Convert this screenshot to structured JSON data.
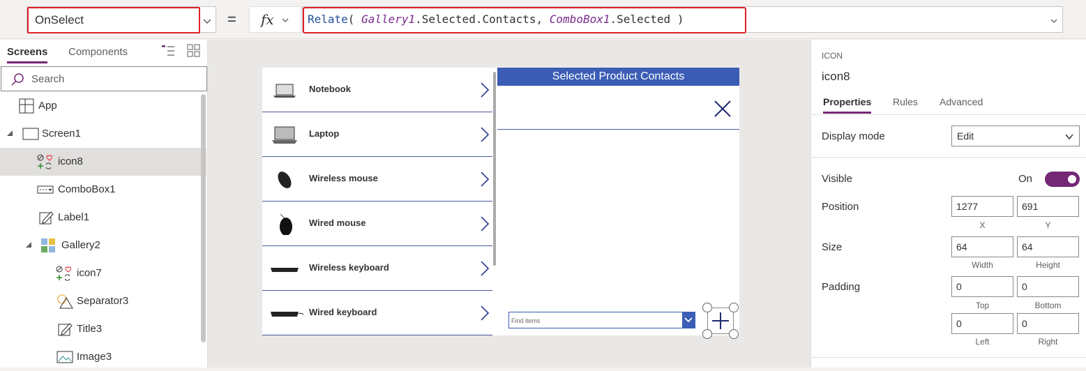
{
  "formula_bar": {
    "property": "OnSelect",
    "equals": "=",
    "fx_label": "fx",
    "formula": {
      "fn": "Relate",
      "p1": "( ",
      "gallery": "Gallery1",
      "mid": ".Selected.Contacts, ",
      "combo": "ComboBox1",
      "end": ".Selected )"
    }
  },
  "left_panel": {
    "tabs": [
      "Screens",
      "Components"
    ],
    "search_placeholder": "Search",
    "tree": [
      {
        "label": "App",
        "icon": "app-icon"
      },
      {
        "label": "Screen1",
        "icon": "screen-icon"
      },
      {
        "label": "icon8",
        "icon": "icon-control-icon",
        "selected": true
      },
      {
        "label": "ComboBox1",
        "icon": "combobox-icon"
      },
      {
        "label": "Label1",
        "icon": "label-icon"
      },
      {
        "label": "Gallery2",
        "icon": "gallery-icon"
      },
      {
        "label": "icon7",
        "icon": "icon-control-icon"
      },
      {
        "label": "Separator3",
        "icon": "shapes-icon"
      },
      {
        "label": "Title3",
        "icon": "label-icon"
      },
      {
        "label": "Image3",
        "icon": "image-icon"
      }
    ]
  },
  "canvas": {
    "gallery": [
      {
        "name": "Notebook",
        "icon": "notebook-image"
      },
      {
        "name": "Laptop",
        "icon": "laptop-image"
      },
      {
        "name": "Wireless mouse",
        "icon": "wireless-mouse-image"
      },
      {
        "name": "Wired mouse",
        "icon": "wired-mouse-image"
      },
      {
        "name": "Wireless keyboard",
        "icon": "wireless-keyboard-image"
      },
      {
        "name": "Wired keyboard",
        "icon": "wired-keyboard-image"
      }
    ],
    "panel_title": "Selected Product Contacts",
    "combo_placeholder": "Find items"
  },
  "properties": {
    "type": "ICON",
    "name": "icon8",
    "tabs": [
      "Properties",
      "Rules",
      "Advanced"
    ],
    "display_mode_label": "Display mode",
    "display_mode_value": "Edit",
    "visible_label": "Visible",
    "visible_value": "On",
    "position_label": "Position",
    "position_x": "1277",
    "position_y": "691",
    "x_label": "X",
    "y_label": "Y",
    "size_label": "Size",
    "width": "64",
    "height": "64",
    "width_label": "Width",
    "height_label": "Height",
    "padding_label": "Padding",
    "padding_top": "0",
    "padding_bottom": "0",
    "padding_left": "0",
    "padding_right": "0",
    "top_label": "Top",
    "bottom_label": "Bottom",
    "left_label": "Left",
    "right_label": "Right"
  },
  "colors": {
    "accent": "#742774",
    "app_blue": "#3b5db5",
    "highlight_red": "#e0202a"
  }
}
